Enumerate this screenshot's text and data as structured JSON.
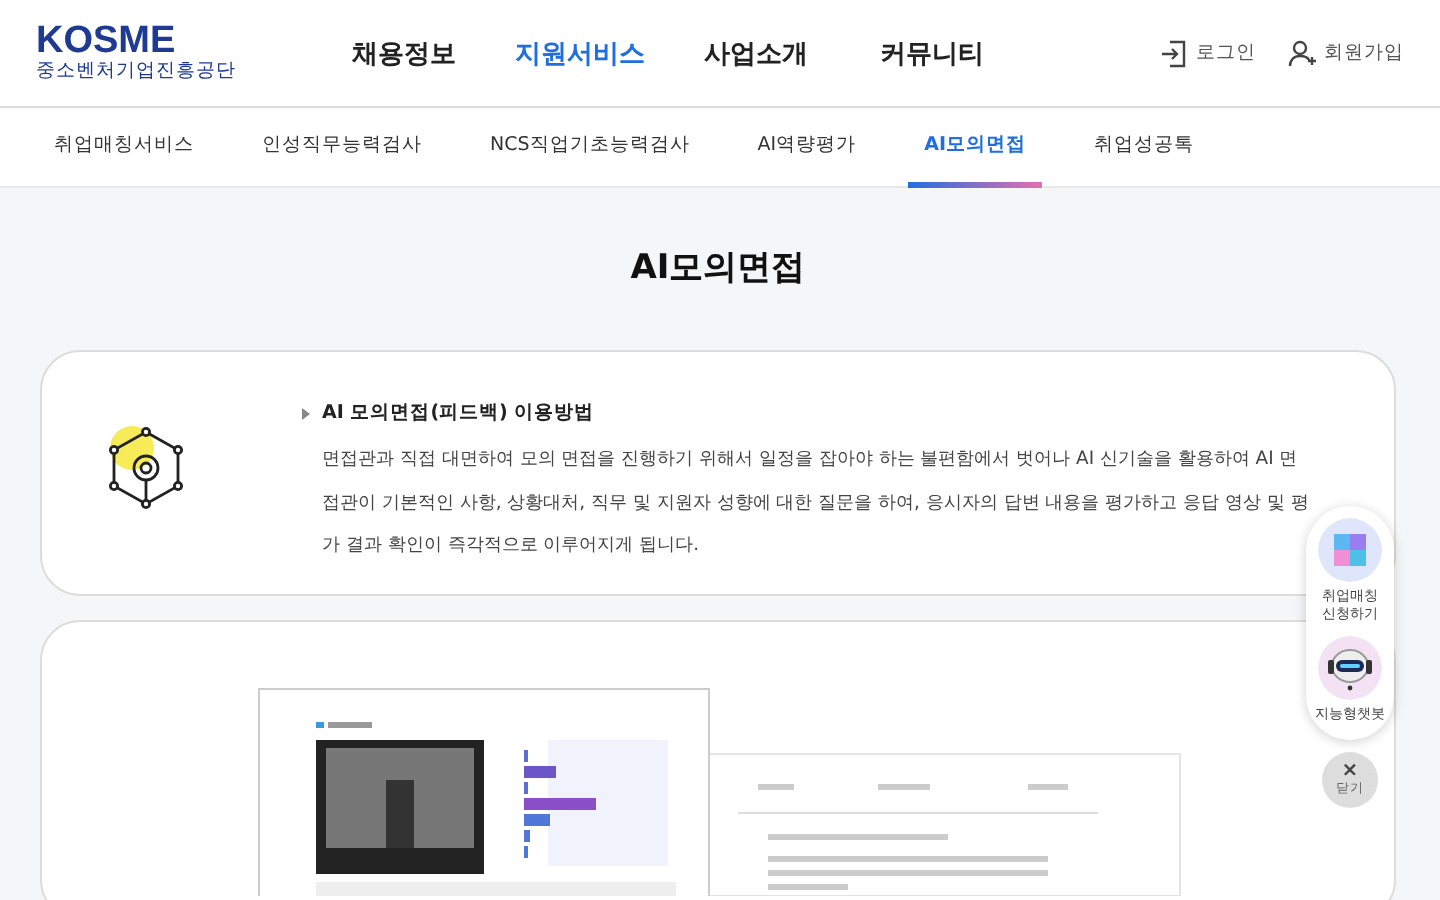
{
  "logo": {
    "name": "KOSME",
    "subtitle": "중소벤처기업진흥공단"
  },
  "main_nav": [
    {
      "label": "채용정보",
      "selected": false
    },
    {
      "label": "지원서비스",
      "selected": true
    },
    {
      "label": "사업소개",
      "selected": false
    },
    {
      "label": "커뮤니티",
      "selected": false
    }
  ],
  "user_links": [
    {
      "kind": "login",
      "label": "로그인"
    },
    {
      "kind": "signup",
      "label": "회원가입"
    }
  ],
  "sub_nav": [
    {
      "label": "취업매칭서비스",
      "selected": false
    },
    {
      "label": "인성직무능력검사",
      "selected": false
    },
    {
      "label": "NCS직업기초능력검사",
      "selected": false
    },
    {
      "label": "AI역량평가",
      "selected": false
    },
    {
      "label": "AI모의면접",
      "selected": true
    },
    {
      "label": "취업성공톡",
      "selected": false
    }
  ],
  "page_title": "AI모의면접",
  "intro_card": {
    "heading": "AI 모의면접(피드백) 이용방법",
    "body": "면접관과 직접 대면하여 모의 면접을 진행하기 위해서 일정을 잡아야 하는 불편함에서 벗어나 AI 신기술을 활용하여 AI 면접관이 기본적인 사항, 상황대처, 직무 및 지원자 성향에 대한 질문을 하여, 응시자의 답변 내용을 평가하고 응답 영상 및 평가 결과 확인이 즉각적으로 이루어지게 됩니다."
  },
  "quick_menu": [
    {
      "kind": "matching",
      "label": "취업매칭\n신청하기"
    },
    {
      "kind": "chatbot",
      "label": "지능형챗봇"
    }
  ],
  "close_button": {
    "symbol": "×",
    "label": "닫기"
  }
}
